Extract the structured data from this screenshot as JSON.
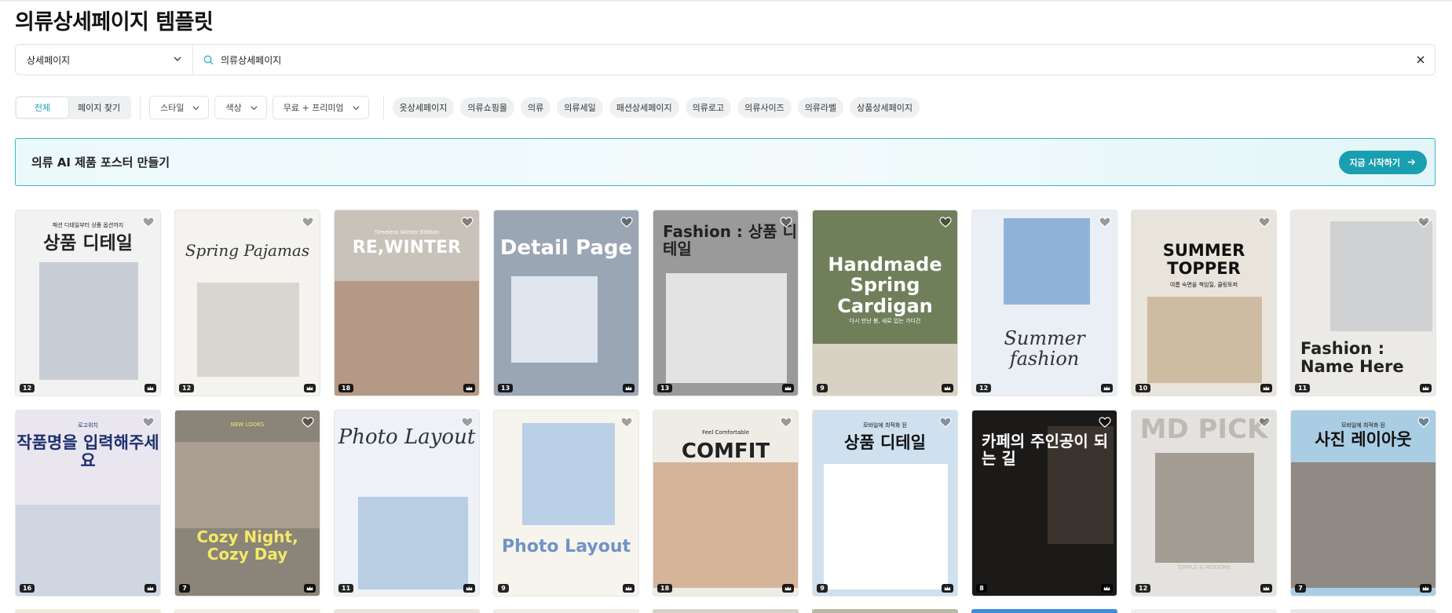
{
  "page": {
    "title": "의류상세페이지 템플릿"
  },
  "search": {
    "category": "상세페이지",
    "query": "의류상세페이지"
  },
  "filters": {
    "segments": [
      {
        "label": "전체",
        "active": true
      },
      {
        "label": "페이지 찾기",
        "active": false
      }
    ],
    "dropdowns": [
      {
        "label": "스타일"
      },
      {
        "label": "색상"
      },
      {
        "label": "무료 + 프리미엄"
      }
    ],
    "tags": [
      "옷상세페이지",
      "의류쇼핑몰",
      "의류",
      "의류세일",
      "패션상세페이지",
      "의류로고",
      "의류사이즈",
      "의류라벨",
      "상품상세페이지"
    ]
  },
  "banner": {
    "title": "의류 AI 제품 포스터 만들기",
    "button": "지금 시작하기"
  },
  "colors": {
    "accent": "#1a9fb0",
    "banner_border": "#38b6c4"
  },
  "templates": [
    {
      "count": "12",
      "title": "상품 디테일",
      "subtitle": "패션 디테일부터 상품 옵션까지",
      "bg": "#f2f2f2",
      "fg": "#222"
    },
    {
      "count": "12",
      "title": "Spring Pajamas",
      "subtitle": "",
      "bg": "#f4f3ef",
      "fg": "#333"
    },
    {
      "count": "18",
      "title": "RE,WINTER",
      "subtitle": "Timeless Winter Edition",
      "bg": "#c8c2b8",
      "fg": "#ffffff"
    },
    {
      "count": "13",
      "title": "Detail Page",
      "subtitle": "",
      "bg": "#9aa6b3",
      "fg": "#ffffff"
    },
    {
      "count": "13",
      "title": "Fashion : 상품 디테일",
      "subtitle": "",
      "bg": "#9a9a9a",
      "fg": "#222"
    },
    {
      "count": "9",
      "title": "Handmade Spring Cardigan",
      "subtitle": "다시 만난 봄, 새로 입는 가디건",
      "bg": "#6f7f5a",
      "fg": "#ffffff"
    },
    {
      "count": "12",
      "title": "Summer fashion",
      "subtitle": "",
      "bg": "#e9eff4",
      "fg": "#333"
    },
    {
      "count": "10",
      "title": "SUMMER TOPPER",
      "subtitle": "여름 숙면을 책임질, 쿨링토퍼",
      "bg": "#e8e4dc",
      "fg": "#111"
    },
    {
      "count": "11",
      "title": "Fashion : Name Here",
      "subtitle": "",
      "bg": "#eceae7",
      "fg": "#222"
    },
    {
      "count": "16",
      "title": "작품명을 입력해주세요",
      "subtitle": "로고위치",
      "bg": "#e9e6ef",
      "fg": "#1d2f6f"
    },
    {
      "count": "7",
      "title": "Cozy Night, Cozy Day",
      "subtitle": "NEW LOOKS",
      "bg": "#8b8478",
      "fg": "#f3e96a"
    },
    {
      "count": "11",
      "title": "Photo Layout",
      "subtitle": "",
      "bg": "#eef1f6",
      "fg": "#2b3446"
    },
    {
      "count": "9",
      "title": "Photo Layout",
      "subtitle": "",
      "bg": "#f7f4ee",
      "fg": "#6f93c6"
    },
    {
      "count": "18",
      "title": "COMFIT",
      "subtitle": "Feel Comfortable",
      "bg": "#efece6",
      "fg": "#222"
    },
    {
      "count": "9",
      "title": "상품 디테일",
      "subtitle": "모바일에 최적화 된",
      "bg": "#cfe0ef",
      "fg": "#111"
    },
    {
      "count": "8",
      "title": "카페의 주인공이 되는 길",
      "subtitle": "",
      "bg": "#1c1a18",
      "fg": "#ffffff"
    },
    {
      "count": "12",
      "title": "MD PICK",
      "subtitle": "SIMPLE & MODERN",
      "bg": "#e4e2de",
      "fg": "#bdbab4"
    },
    {
      "count": "7",
      "title": "사진 레이아웃",
      "subtitle": "모바일에 최적화 된",
      "bg": "#a9cde3",
      "fg": "#111"
    }
  ],
  "row3_colors": [
    "#efe9de",
    "#f2ece3",
    "#e9e5da",
    "#ecebe6",
    "#d6d2c8",
    "#b7b9a3",
    "#3d8de0",
    "#efefef",
    "#e9e9e9"
  ]
}
